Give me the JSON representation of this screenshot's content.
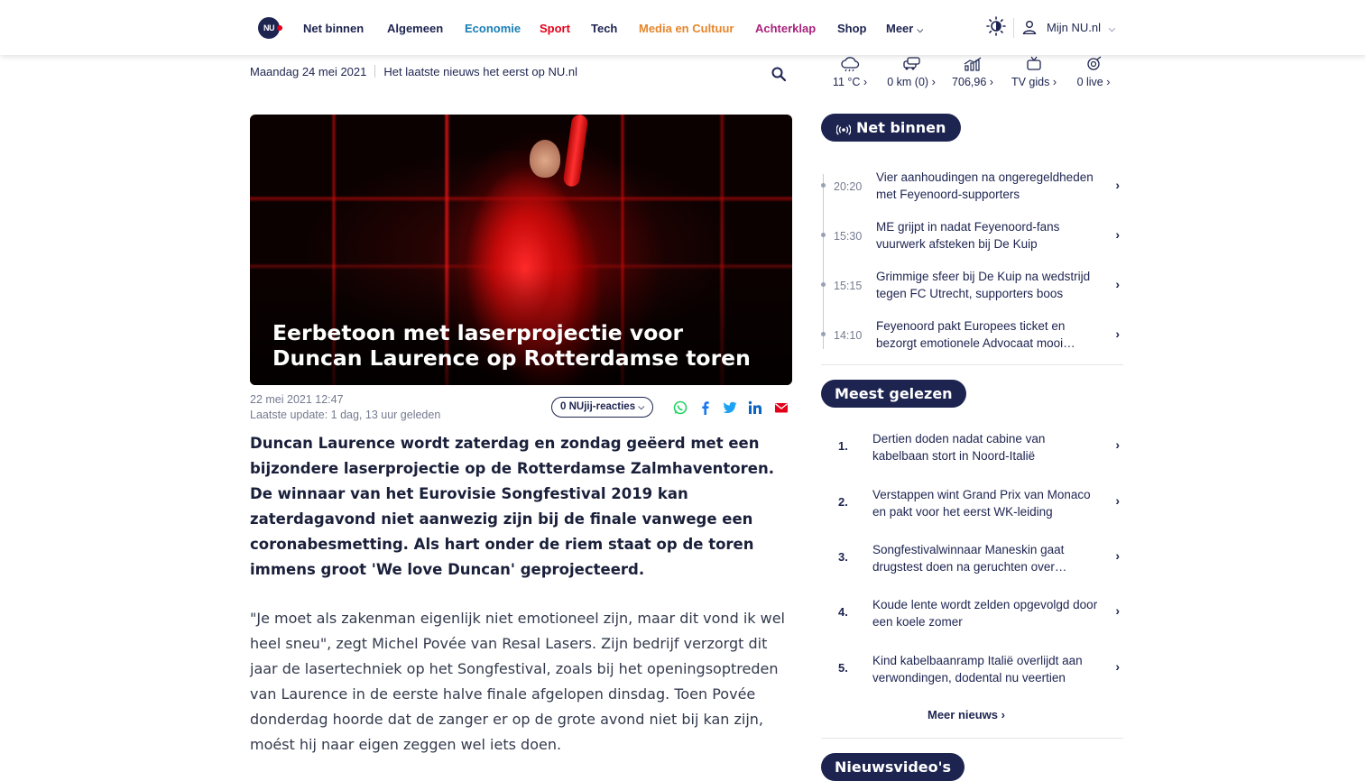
{
  "header": {
    "logo_text": "NU",
    "nav": [
      {
        "label": "Net binnen",
        "color": "#1d2450"
      },
      {
        "label": "Algemeen",
        "color": "#1d2450"
      },
      {
        "label": "Economie",
        "color": "#1a7fb5"
      },
      {
        "label": "Sport",
        "color": "#e5001a"
      },
      {
        "label": "Tech",
        "color": "#1d2450"
      },
      {
        "label": "Media en Cultuur",
        "color": "#e8852a"
      },
      {
        "label": "Achterklap",
        "color": "#a8237c"
      },
      {
        "label": "Shop",
        "color": "#1d2450"
      },
      {
        "label": "Meer",
        "color": "#1d2450"
      }
    ],
    "account_label": "Mijn NU.nl"
  },
  "dateline": {
    "date": "Maandag 24 mei 2021",
    "tagline": "Het laatste nieuws het eerst op NU.nl"
  },
  "widgets": [
    {
      "icon": "weather-icon",
      "label": "11 °C"
    },
    {
      "icon": "traffic-icon",
      "label": "0 km (0)"
    },
    {
      "icon": "stocks-icon",
      "label": "706,96"
    },
    {
      "icon": "tv-icon",
      "label": "TV gids"
    },
    {
      "icon": "live-icon",
      "label": "0 live"
    }
  ],
  "article": {
    "title": "Eerbetoon met laserprojectie voor Duncan Laurence op Rotterdamse toren",
    "published": "22 mei 2021 12:47",
    "updated_prefix": "Laatste update: ",
    "updated_value": "1 dag, 13 uur geleden",
    "reactions_label": "0 NUjij-reacties",
    "intro": "Duncan Laurence wordt zaterdag en zondag geëerd met een bijzondere laserprojectie op de Rotterdamse Zalmhaventoren. De winnaar van het Eurovisie Songfestival 2019 kan zaterdagavond niet aanwezig zijn bij de finale vanwege een coronabesmetting. Als hart onder de riem staat op de toren immens groot 'We love Duncan' geprojecteerd.",
    "paragraph": "\"Je moet als zakenman eigenlijk niet emotioneel zijn, maar dit vond ik wel heel sneu\", zegt Michel Povée van Resal Lasers. Zijn bedrijf verzorgt dit jaar de lasertechniek op het Songfestival, zoals bij het openingsoptreden van Laurence in de eerste halve finale afgelopen dinsdag. Toen Povée donderdag hoorde dat de zanger er op de grote avond niet bij kan zijn, moést hij naar eigen zeggen wel iets doen."
  },
  "share_colors": {
    "whatsapp": "#25d366",
    "facebook": "#1877f2",
    "twitter": "#1da1f2",
    "linkedin": "#0a66c2",
    "email": "#e5001a"
  },
  "net_binnen": {
    "heading": "Net binnen",
    "items": [
      {
        "time": "20:20",
        "title": "Vier aanhoudingen na ongeregeldheden met Feyenoord-supporters"
      },
      {
        "time": "15:30",
        "title": "ME grijpt in nadat Feyenoord-fans vuurwerk afsteken bij De Kuip"
      },
      {
        "time": "15:15",
        "title": "Grimmige sfeer bij De Kuip na wedstrijd tegen FC Utrecht, supporters boos"
      },
      {
        "time": "14:10",
        "title": "Feyenoord pakt Europees ticket en bezorgt emotionele Advocaat mooi afscheid"
      }
    ]
  },
  "meest_gelezen": {
    "heading": "Meest gelezen",
    "items": [
      {
        "num": "1.",
        "title": "Dertien doden nadat cabine van kabelbaan stort in Noord-Italië"
      },
      {
        "num": "2.",
        "title": "Verstappen wint Grand Prix van Monaco en pakt voor het eerst WK-leiding"
      },
      {
        "num": "3.",
        "title": "Songfestivalwinnaar Maneskin gaat drugstest doen na geruchten over cocaïne"
      },
      {
        "num": "4.",
        "title": "Koude lente wordt zelden opgevolgd door een koele zomer"
      },
      {
        "num": "5.",
        "title": "Kind kabelbaanramp Italië overlijdt aan verwondingen, dodental nu veertien"
      }
    ],
    "more_label": "Meer nieuws"
  },
  "nieuwsvideos": {
    "heading": "Nieuwsvideo's"
  }
}
